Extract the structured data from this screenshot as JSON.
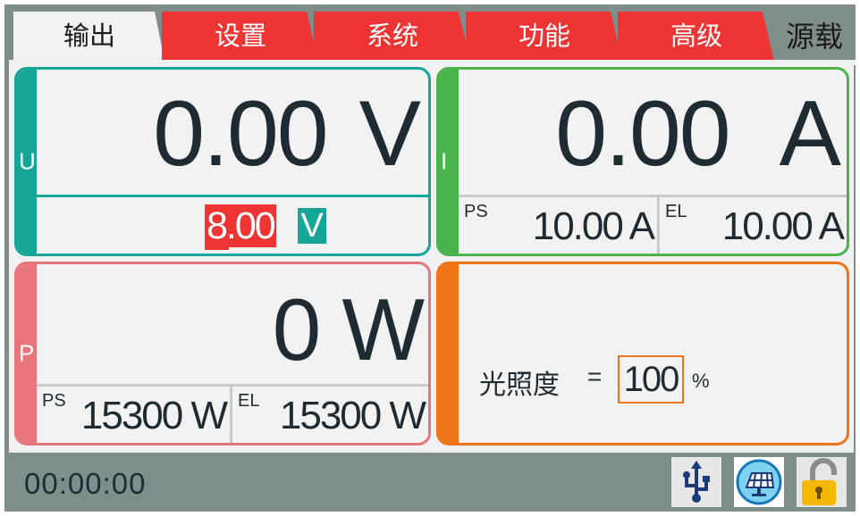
{
  "tabs": [
    {
      "label": "输出",
      "active": true
    },
    {
      "label": "设置",
      "active": false
    },
    {
      "label": "系统",
      "active": false
    },
    {
      "label": "功能",
      "active": false
    },
    {
      "label": "高级",
      "active": false
    }
  ],
  "mode_label": "源载",
  "voltage": {
    "strip": "U",
    "value": "0.00",
    "unit": "V",
    "setpoint": "8.00",
    "setpoint_unit": "V",
    "accent_color": "#16a698"
  },
  "current": {
    "strip": "I",
    "value": "0.00",
    "unit": "A",
    "ps_label": "PS",
    "ps_value": "10.00 A",
    "el_label": "EL",
    "el_value": "10.00 A",
    "accent_color": "#4bb34b"
  },
  "power": {
    "strip": "P",
    "value": "0 W",
    "ps_label": "PS",
    "ps_value": "15300 W",
    "el_label": "EL",
    "el_value": "15300 W",
    "accent_color": "#e8757c"
  },
  "irradiance": {
    "label": "光照度",
    "equals": "=",
    "value": "100",
    "unit": "%",
    "accent_color": "#f07418"
  },
  "status": {
    "time": "00:00:00",
    "icons": [
      "usb-icon",
      "solar-panel-icon",
      "unlock-icon"
    ]
  }
}
